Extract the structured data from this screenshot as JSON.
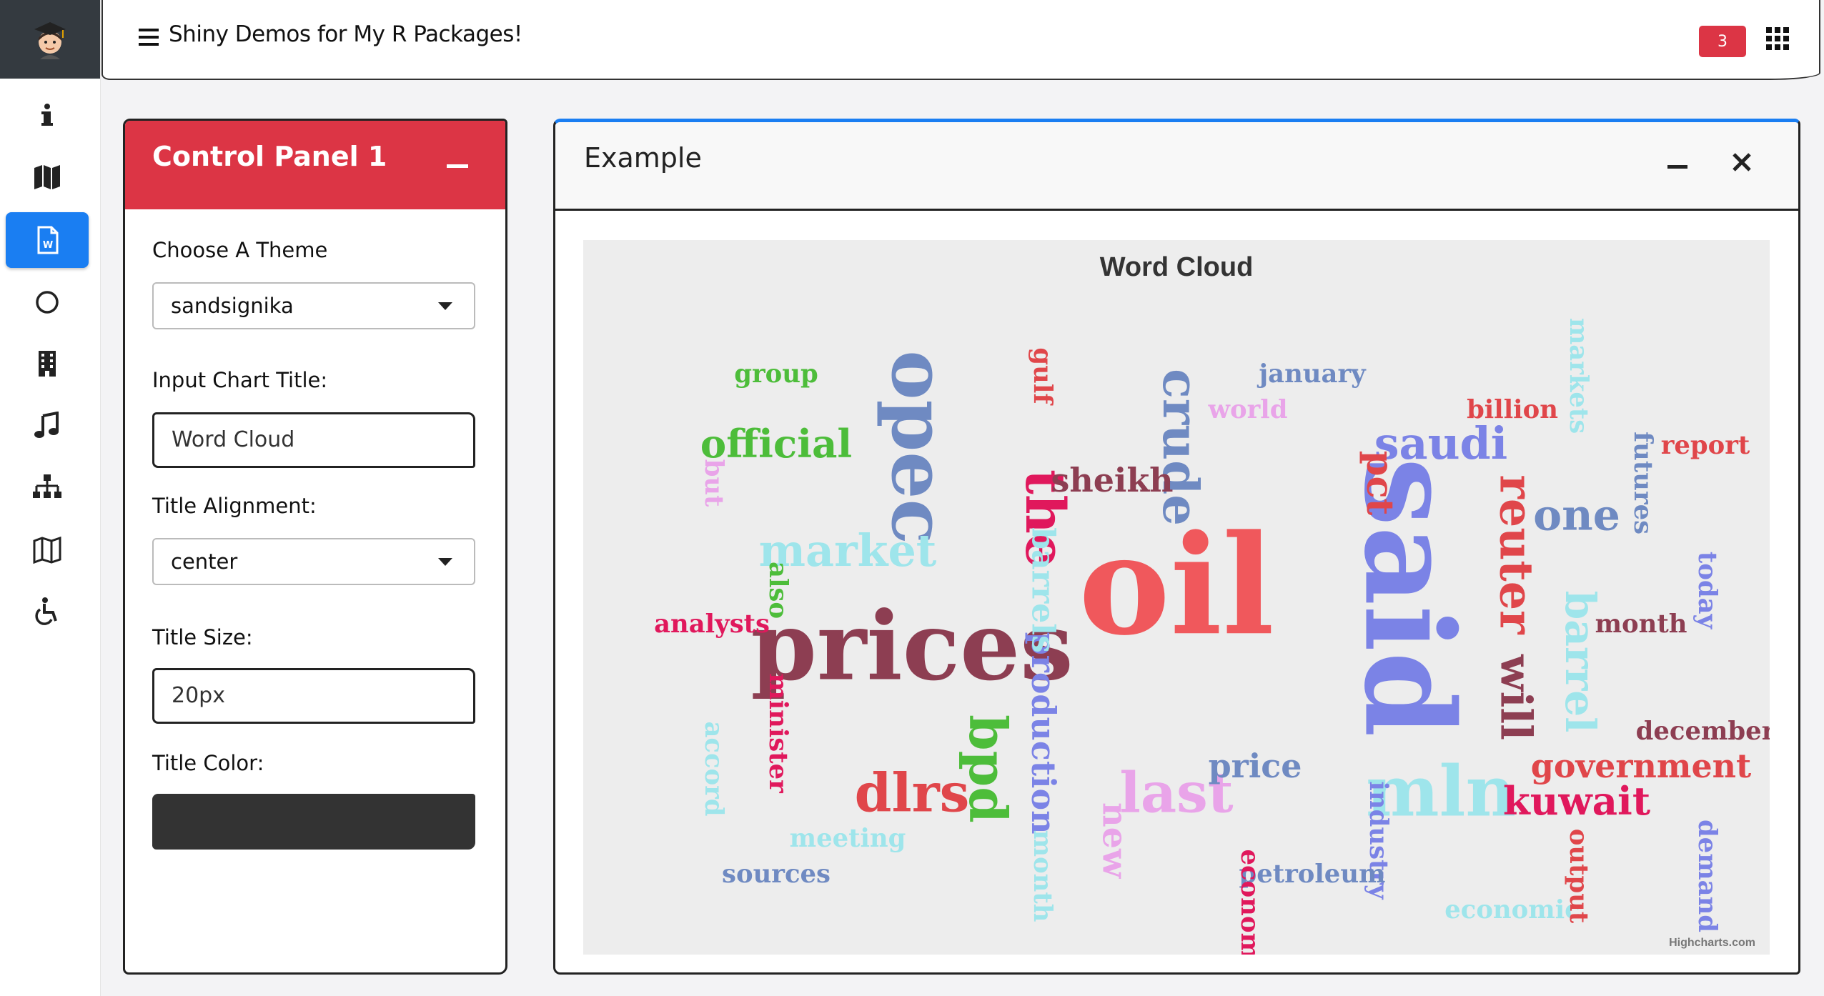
{
  "navbar": {
    "title": "Shiny Demos for My R Packages!",
    "notification_count": "3"
  },
  "sidebar": {
    "items": [
      {
        "icon": "info-icon",
        "active": false
      },
      {
        "icon": "map-icon",
        "active": false
      },
      {
        "icon": "word-document-icon",
        "active": true
      },
      {
        "icon": "circle-icon",
        "active": false
      },
      {
        "icon": "building-icon",
        "active": false
      },
      {
        "icon": "music-icon",
        "active": false
      },
      {
        "icon": "sitemap-icon",
        "active": false
      },
      {
        "icon": "map-outline-icon",
        "active": false
      },
      {
        "icon": "wheelchair-icon",
        "active": false
      }
    ]
  },
  "control_panel": {
    "title": "Control Panel 1",
    "theme_label": "Choose A Theme",
    "theme_value": "sandsignika",
    "chart_title_label": "Input Chart Title:",
    "chart_title_value": "Word Cloud",
    "alignment_label": "Title Alignment:",
    "alignment_value": "center",
    "size_label": "Title Size:",
    "size_value": "20px",
    "color_label": "Title Color:",
    "color_value": "#333333"
  },
  "example": {
    "title": "Example"
  },
  "colors": {
    "accent_blue": "#1a7ef2",
    "danger_red": "#dc3545",
    "dark": "#343a40"
  },
  "chart_data": {
    "type": "wordcloud",
    "title": "Word Cloud",
    "credits": "Highcharts.com",
    "words": [
      {
        "text": "oil",
        "weight": 100,
        "color": "#f0585c"
      },
      {
        "text": "said",
        "weight": 88,
        "color": "#7b83e6"
      },
      {
        "text": "prices",
        "weight": 66,
        "color": "#8d3e52"
      },
      {
        "text": "opec",
        "weight": 50,
        "color": "#6f8ac2"
      },
      {
        "text": "mln",
        "weight": 46,
        "color": "#9ee5eb"
      },
      {
        "text": "crude",
        "weight": 30,
        "color": "#6f8ac2"
      },
      {
        "text": "the",
        "weight": 34,
        "color": "#e0185c"
      },
      {
        "text": "dlrs",
        "weight": 33,
        "color": "#e0464a"
      },
      {
        "text": "last",
        "weight": 35,
        "color": "#e9a4e9"
      },
      {
        "text": "bpd",
        "weight": 32,
        "color": "#4dbd3a"
      },
      {
        "text": "reuter",
        "weight": 27,
        "color": "#e0464a"
      },
      {
        "text": "market",
        "weight": 26,
        "color": "#9ee5eb"
      },
      {
        "text": "saudi",
        "weight": 26,
        "color": "#7b83e6"
      },
      {
        "text": "one",
        "weight": 25,
        "color": "#6f8ac2"
      },
      {
        "text": "will",
        "weight": 25,
        "color": "#8d3e52"
      },
      {
        "text": "barrel",
        "weight": 24,
        "color": "#9ee5eb"
      },
      {
        "text": "kuwait",
        "weight": 22,
        "color": "#e0185c"
      },
      {
        "text": "official",
        "weight": 22,
        "color": "#4dbd3a"
      },
      {
        "text": "pct",
        "weight": 20,
        "color": "#e0464a"
      },
      {
        "text": "production",
        "weight": 17,
        "color": "#7b83e6"
      },
      {
        "text": "government",
        "weight": 17,
        "color": "#e0464a"
      },
      {
        "text": "price",
        "weight": 17,
        "color": "#6f8ac2"
      },
      {
        "text": "new",
        "weight": 18,
        "color": "#e9a4e9"
      },
      {
        "text": "sheikh",
        "weight": 17,
        "color": "#8d3e52"
      },
      {
        "text": "barrels",
        "weight": 16,
        "color": "#9ee5eb"
      },
      {
        "text": "futures",
        "weight": 11,
        "color": "#6f8ac2"
      },
      {
        "text": "industry",
        "weight": 11,
        "color": "#7b83e6"
      },
      {
        "text": "petroleum",
        "weight": 11,
        "color": "#6f8ac2"
      },
      {
        "text": "january",
        "weight": 11,
        "color": "#6f8ac2"
      },
      {
        "text": "billion",
        "weight": 11,
        "color": "#e0464a"
      },
      {
        "text": "report",
        "weight": 11,
        "color": "#e0464a"
      },
      {
        "text": "world",
        "weight": 11,
        "color": "#e9a4e9"
      },
      {
        "text": "group",
        "weight": 11,
        "color": "#4dbd3a"
      },
      {
        "text": "gulf",
        "weight": 11,
        "color": "#e0464a"
      },
      {
        "text": "markets",
        "weight": 11,
        "color": "#9ee5eb"
      },
      {
        "text": "but",
        "weight": 11,
        "color": "#e9a4e9"
      },
      {
        "text": "also",
        "weight": 11,
        "color": "#4dbd3a"
      },
      {
        "text": "analysts",
        "weight": 11,
        "color": "#e0185c"
      },
      {
        "text": "minister",
        "weight": 11,
        "color": "#e0185c"
      },
      {
        "text": "accord",
        "weight": 11,
        "color": "#9ee5eb"
      },
      {
        "text": "meeting",
        "weight": 11,
        "color": "#9ee5eb"
      },
      {
        "text": "sources",
        "weight": 11,
        "color": "#6f8ac2"
      },
      {
        "text": "month",
        "weight": 11,
        "color": "#8d3e52"
      },
      {
        "text": "economy",
        "weight": 11,
        "color": "#e0185c"
      },
      {
        "text": "economic",
        "weight": 11,
        "color": "#9ee5eb"
      },
      {
        "text": "output",
        "weight": 11,
        "color": "#e0464a"
      },
      {
        "text": "demand",
        "weight": 11,
        "color": "#7b83e6"
      },
      {
        "text": "today",
        "weight": 11,
        "color": "#7b83e6"
      },
      {
        "text": "december",
        "weight": 11,
        "color": "#8d3e52"
      },
      {
        "text": "month",
        "weight": 11,
        "color": "#9ee5eb"
      }
    ]
  }
}
